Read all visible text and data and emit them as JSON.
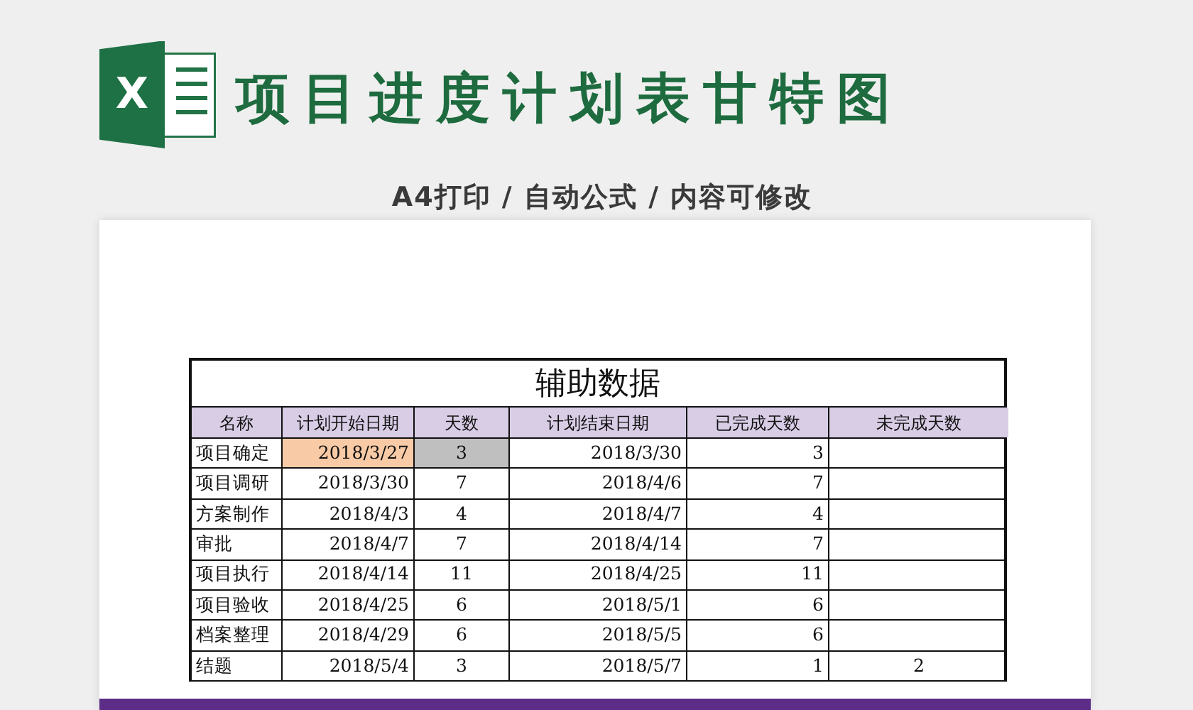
{
  "logo": {
    "letter": "X"
  },
  "title": "项目进度计划表甘特图",
  "subtitle": "A4打印 / 自动公式 / 内容可修改",
  "table": {
    "title": "辅助数据",
    "columns": [
      "名称",
      "计划开始日期",
      "天数",
      "计划结束日期",
      "已完成天数",
      "未完成天数"
    ],
    "rows": [
      {
        "cells": [
          "项目确定",
          {
            "text": "2018/3/27",
            "color": "#f8cba6"
          },
          {
            "text": "3",
            "color": "#bfbfbf"
          },
          "2018/3/30",
          "3"
        ]
      },
      {
        "cells": [
          "项目调研",
          "2018/3/30",
          "7",
          "2018/4/6",
          "7"
        ]
      },
      {
        "cells": [
          "方案制作",
          "2018/4/3",
          "4",
          "2018/4/7",
          "4"
        ]
      },
      {
        "cells": [
          "审批",
          "2018/4/7",
          "7",
          "2018/4/14",
          "7"
        ]
      },
      {
        "cells": [
          "项目执行",
          "2018/4/14",
          "11",
          "2018/4/25",
          "11"
        ]
      },
      {
        "cells": [
          "项目验收",
          "2018/4/25",
          "6",
          "2018/5/1",
          "6"
        ]
      },
      {
        "cells": [
          "档案整理",
          "2018/4/29",
          "6",
          "2018/5/5",
          "6"
        ]
      },
      {
        "cells": [
          "结题",
          "2018/5/4",
          "3",
          "2018/5/7",
          "1",
          "2"
        ]
      }
    ]
  }
}
